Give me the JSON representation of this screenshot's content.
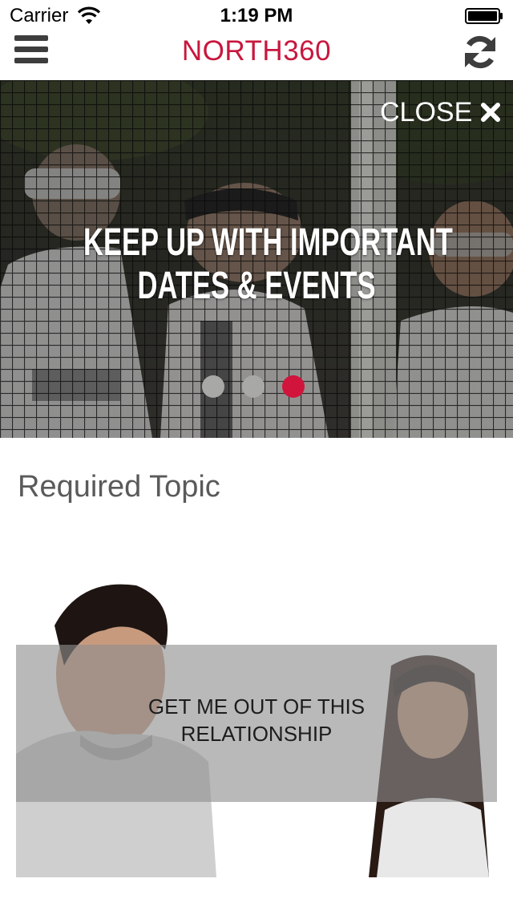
{
  "status_bar": {
    "carrier": "Carrier",
    "time": "1:19 PM",
    "wifi_icon": "wifi-icon",
    "battery_icon": "battery-icon"
  },
  "nav": {
    "title": "NORTH360",
    "menu_icon": "hamburger-menu-icon",
    "refresh_icon": "refresh-icon",
    "title_color": "#c8173e"
  },
  "hero": {
    "close_label": "CLOSE",
    "close_icon": "close-x-icon",
    "headline_line1": "KEEP UP WITH IMPORTANT",
    "headline_line2": "DATES & EVENTS",
    "slides_total": 3,
    "active_slide": 3,
    "active_dot_color": "#d0143b",
    "inactive_dot_color": "#a8a8a6"
  },
  "content": {
    "section_title": "Required Topic",
    "topic_caption_line1": "GET ME OUT OF THIS",
    "topic_caption_line2": "RELATIONSHIP"
  }
}
